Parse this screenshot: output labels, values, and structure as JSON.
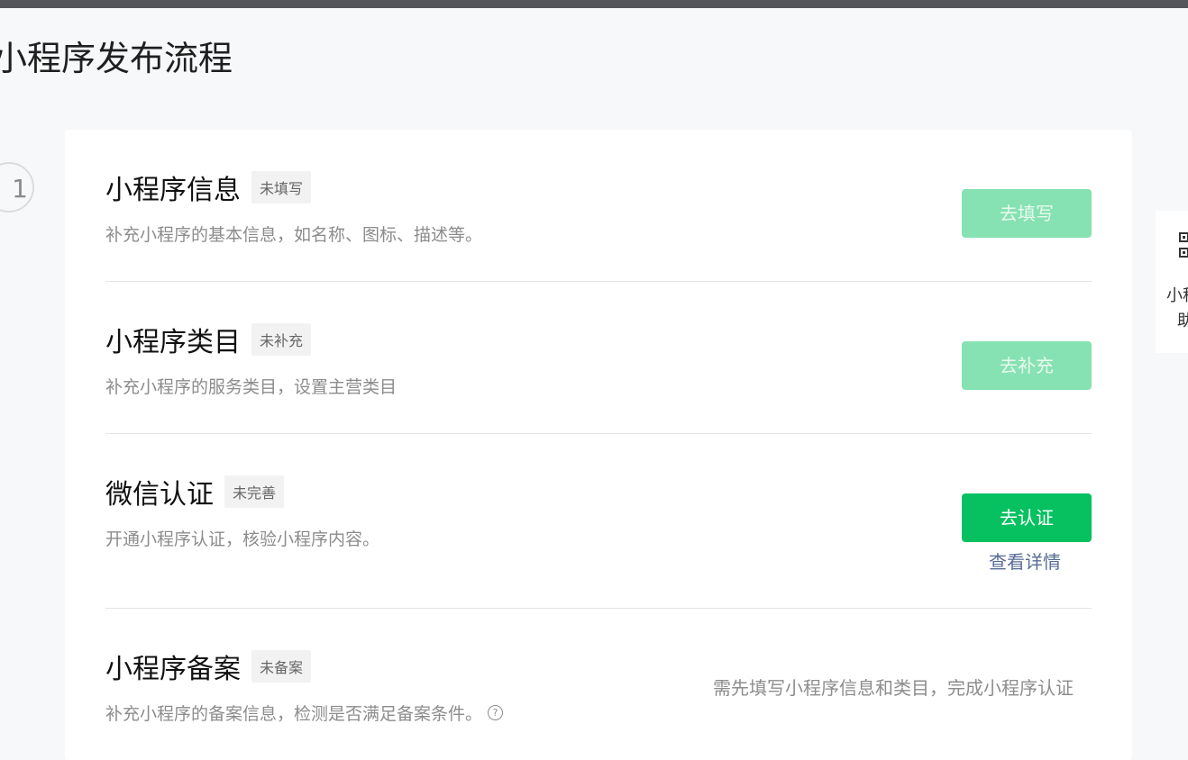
{
  "page": {
    "title": "小程序发布流程",
    "step_number": "1"
  },
  "steps": [
    {
      "title": "小程序信息",
      "tag": "未填写",
      "description": "补充小程序的基本信息，如名称、图标、描述等。",
      "button_label": "去填写",
      "button_state": "disabled"
    },
    {
      "title": "小程序类目",
      "tag": "未补充",
      "description": "补充小程序的服务类目，设置主营类目",
      "button_label": "去补充",
      "button_state": "disabled"
    },
    {
      "title": "微信认证",
      "tag": "未完善",
      "description": "开通小程序认证，核验小程序内容。",
      "button_label": "去认证",
      "button_state": "enabled",
      "link_label": "查看详情"
    },
    {
      "title": "小程序备案",
      "tag": "未备案",
      "description": "补充小程序的备案信息，检测是否满足备案条件。",
      "hint": "需先填写小程序信息和类目，完成小程序认证"
    }
  ],
  "side_panel": {
    "line1": "小程",
    "line2": "助手",
    "icon": "qrcode-icon"
  },
  "colors": {
    "primary": "#07c160",
    "primary_disabled": "#86e2b2",
    "link": "#576b95",
    "topbar": "#55555c"
  }
}
